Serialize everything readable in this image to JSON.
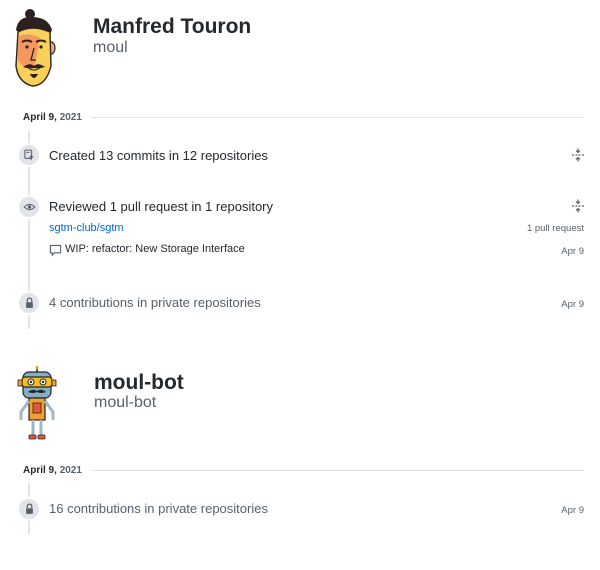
{
  "users": [
    {
      "name": "Manfred Touron",
      "login": "moul",
      "date": {
        "day": "April 9,",
        "year": "2021"
      },
      "activities": [
        {
          "summary": "Created 13 commits in 12 repositories"
        },
        {
          "summary": "Reviewed 1 pull request in 1 repository",
          "repo": "sgtm-club/sgtm",
          "repo_count": "1 pull request",
          "pr_title": "WIP: refactor: New Storage Interface",
          "pr_date": "Apr 9"
        },
        {
          "summary": "4 contributions in private repositories",
          "date": "Apr 9"
        }
      ]
    },
    {
      "name": "moul-bot",
      "login": "moul-bot",
      "date": {
        "day": "April 9,",
        "year": "2021"
      },
      "activities": [
        {
          "summary": "16 contributions in private repositories",
          "date": "Apr 9"
        }
      ]
    }
  ],
  "colors": {
    "link": "#0366d6",
    "text": "#24292e",
    "muted": "#586069",
    "border": "#e1e4e8"
  },
  "icons": {
    "commit": "repo-push-icon",
    "review": "eye-icon",
    "private": "lock-icon",
    "fold": "fold-icon",
    "comment": "comment-icon"
  }
}
